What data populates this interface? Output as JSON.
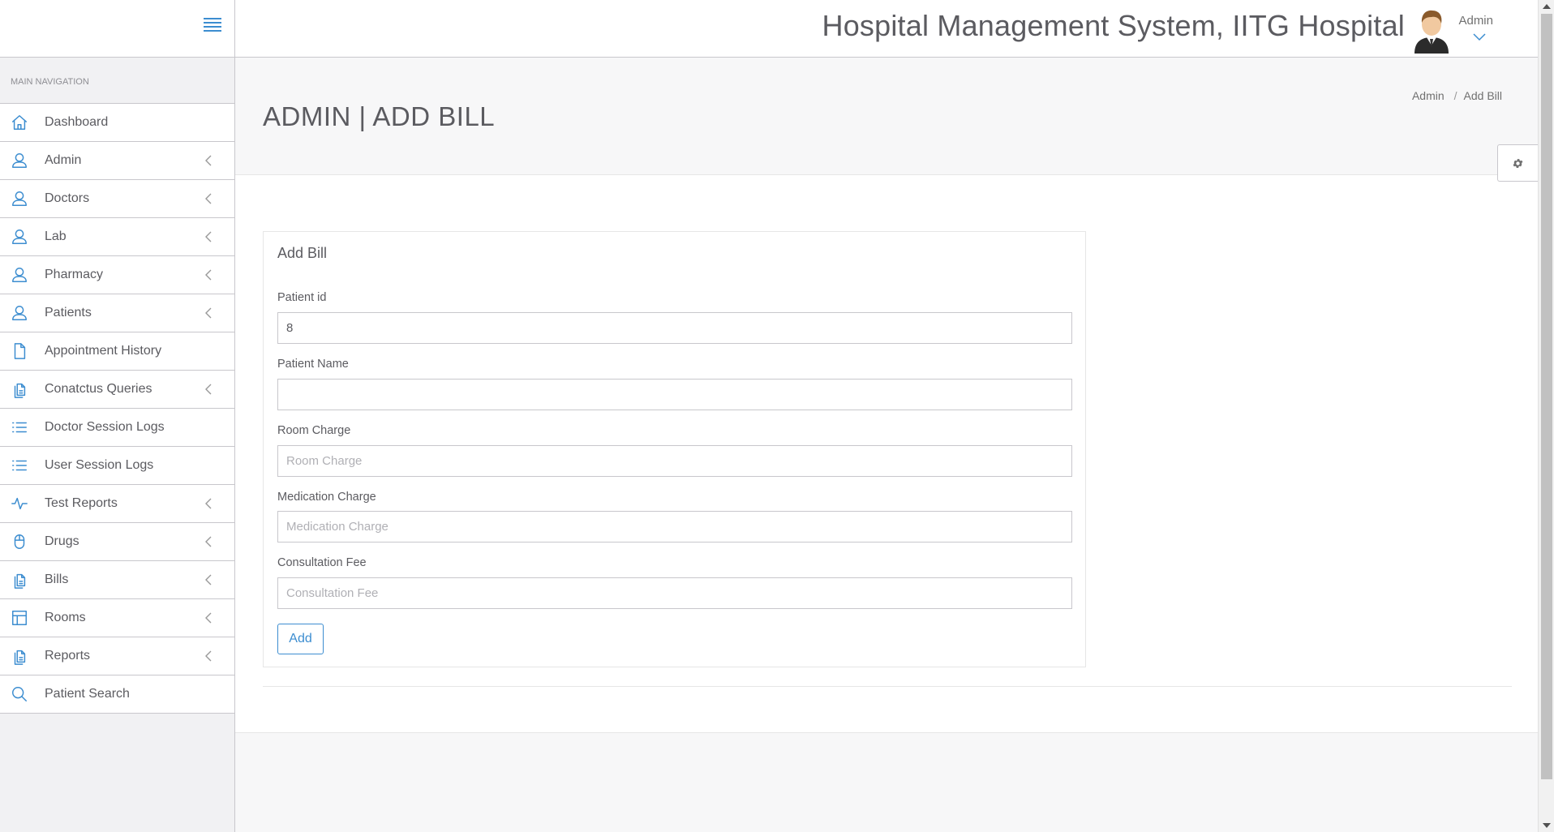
{
  "header": {
    "app_title": "Hospital Management System, IITG Hospital",
    "user_name": "Admin"
  },
  "sidebar": {
    "heading": "MAIN NAVIGATION",
    "items": [
      {
        "label": "Dashboard",
        "icon": "home-icon",
        "chevron": false
      },
      {
        "label": "Admin",
        "icon": "user-icon",
        "chevron": true
      },
      {
        "label": "Doctors",
        "icon": "user-icon",
        "chevron": true
      },
      {
        "label": "Lab",
        "icon": "user-icon",
        "chevron": true
      },
      {
        "label": "Pharmacy",
        "icon": "user-icon",
        "chevron": true
      },
      {
        "label": "Patients",
        "icon": "user-icon",
        "chevron": true
      },
      {
        "label": "Appointment History",
        "icon": "file-icon",
        "chevron": false
      },
      {
        "label": "Conatctus Queries",
        "icon": "files-icon",
        "chevron": true
      },
      {
        "label": "Doctor Session Logs",
        "icon": "list-icon",
        "chevron": false
      },
      {
        "label": "User Session Logs",
        "icon": "list-icon",
        "chevron": false
      },
      {
        "label": "Test Reports",
        "icon": "pulse-icon",
        "chevron": true
      },
      {
        "label": "Drugs",
        "icon": "mouse-icon",
        "chevron": true
      },
      {
        "label": "Bills",
        "icon": "files-icon",
        "chevron": true
      },
      {
        "label": "Rooms",
        "icon": "layout-icon",
        "chevron": true
      },
      {
        "label": "Reports",
        "icon": "files-icon",
        "chevron": true
      },
      {
        "label": "Patient Search",
        "icon": "search-icon",
        "chevron": false
      }
    ]
  },
  "page": {
    "title": "ADMIN | ADD BILL",
    "breadcrumb": [
      "Admin",
      "Add Bill"
    ]
  },
  "form": {
    "title": "Add Bill",
    "fields": [
      {
        "label": "Patient id",
        "value": "8",
        "placeholder": ""
      },
      {
        "label": "Patient Name",
        "value": "",
        "placeholder": ""
      },
      {
        "label": "Room Charge",
        "value": "",
        "placeholder": "Room Charge"
      },
      {
        "label": "Medication Charge",
        "value": "",
        "placeholder": "Medication Charge"
      },
      {
        "label": "Consultation Fee",
        "value": "",
        "placeholder": "Consultation Fee"
      }
    ],
    "submit_label": "Add"
  },
  "colors": {
    "accent": "#3c8dd0",
    "sidebar_bg": "#f1f1f3",
    "text": "#5b5b60"
  }
}
